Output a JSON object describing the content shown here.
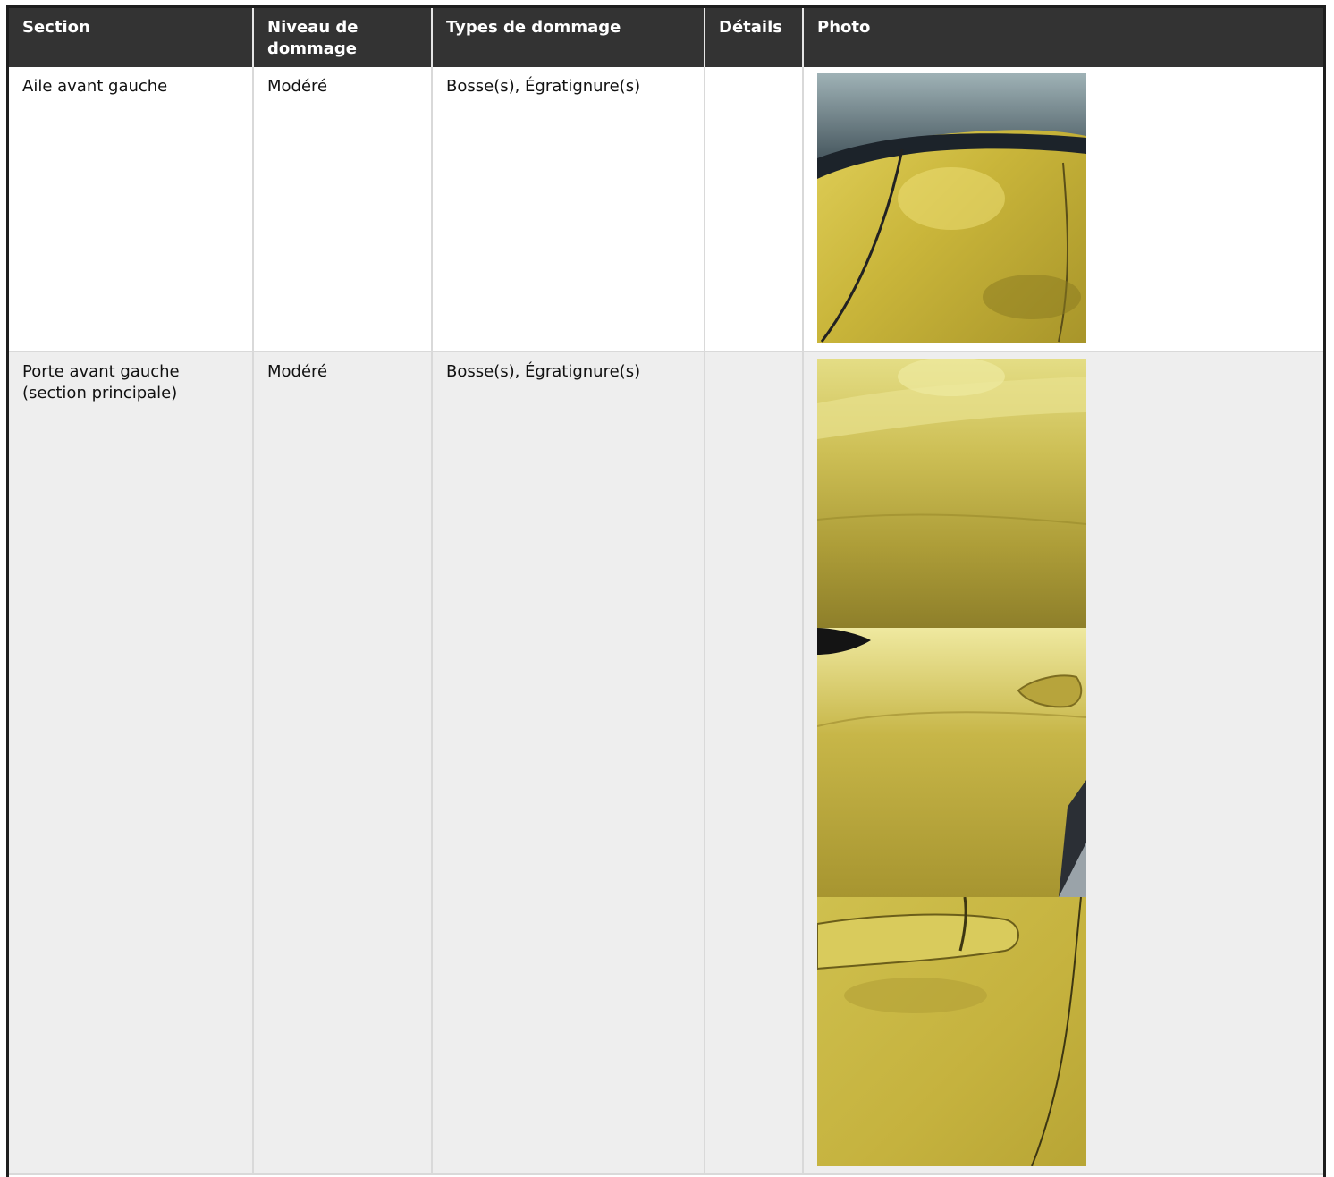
{
  "table": {
    "headers": [
      "Section",
      "Niveau de dommage",
      "Types de dommage",
      "Détails",
      "Photo"
    ],
    "rows": [
      {
        "section": "Aile avant gauche",
        "niveau": "Modéré",
        "types": "Bosse(s), Égratignure(s)",
        "details": "",
        "photos": [
          "car-fender-photo"
        ]
      },
      {
        "section": "Porte avant gauche (section principale)",
        "niveau": "Modéré",
        "types": "Bosse(s), Égratignure(s)",
        "details": "",
        "photos": [
          "car-door-photo-1",
          "car-door-photo-2",
          "car-door-photo-3"
        ]
      }
    ]
  },
  "colors": {
    "header_bg": "#333333",
    "header_text": "#ffffff",
    "row_alt_bg": "#eeeeee",
    "car_paint": "#c9b53a"
  }
}
